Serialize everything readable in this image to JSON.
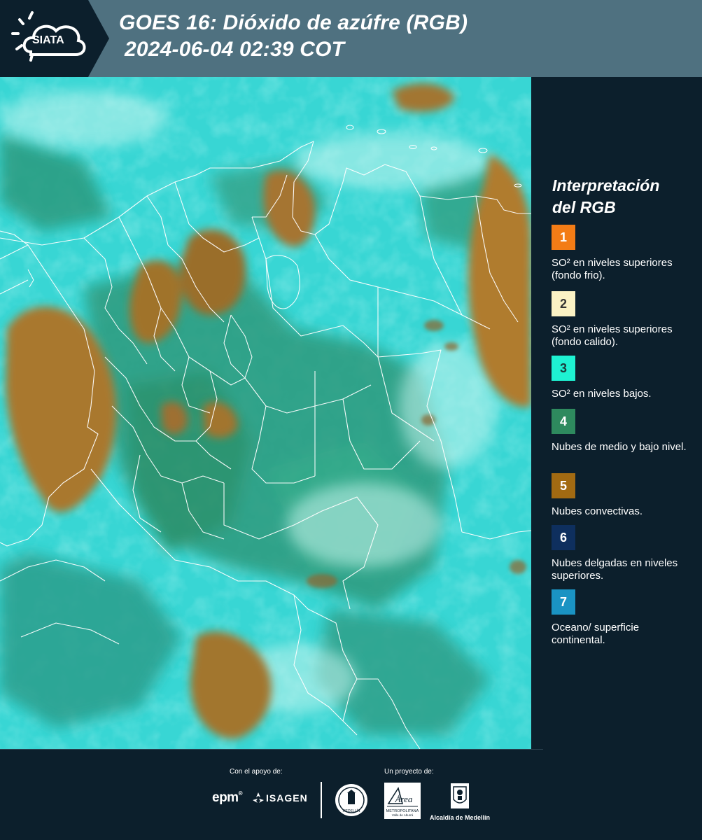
{
  "header": {
    "logo_text": "SIATA",
    "title_line1": "GOES 16: Dióxido de azúfre (RGB)",
    "title_line2": "2024-06-04 02:39 COT",
    "background": "#4f7180"
  },
  "legend": {
    "title_line1": "Interpretación",
    "title_line2": "del RGB",
    "items": [
      {
        "number": "1",
        "color": "#f37c16",
        "number_color": "#ffffff",
        "text": "SO² en niveles superiores (fondo frio)."
      },
      {
        "number": "2",
        "color": "#fbf2c4",
        "number_color": "#333333",
        "text": "SO² en niveles superiores (fondo calido)."
      },
      {
        "number": "3",
        "color": "#1ef2d2",
        "number_color": "#1d3a3a",
        "text": "SO² en niveles bajos."
      },
      {
        "number": "4",
        "color": "#2e8a5e",
        "number_color": "#ffffff",
        "text": "Nubes de medio y bajo nivel."
      },
      {
        "number": "5",
        "color": "#a26a12",
        "number_color": "#ffffff",
        "text": "Nubes convectivas."
      },
      {
        "number": "6",
        "color": "#0e2f5e",
        "number_color": "#ffffff",
        "text": "Nubes delgadas en niveles superiores."
      },
      {
        "number": "7",
        "color": "#1a93c3",
        "number_color": "#ffffff",
        "text": "Oceano/ superficie continental."
      }
    ]
  },
  "footer": {
    "support_label": "Con el apoyo de:",
    "project_label": "Un proyecto de:",
    "epm": "epm",
    "isagen": "ISAGEN",
    "area_text": "Área",
    "area_sub": "METROPOLITANA",
    "area_sub2": "Valle de Aburrá",
    "alcaldia": "Alcaldía de Medellín",
    "seal_text": "MEDELLÍN"
  },
  "colors": {
    "cyan": "#37d8d8",
    "teal": "#2c9f8c",
    "convective": "#a87b2e",
    "panel": "#0c1f2c"
  }
}
